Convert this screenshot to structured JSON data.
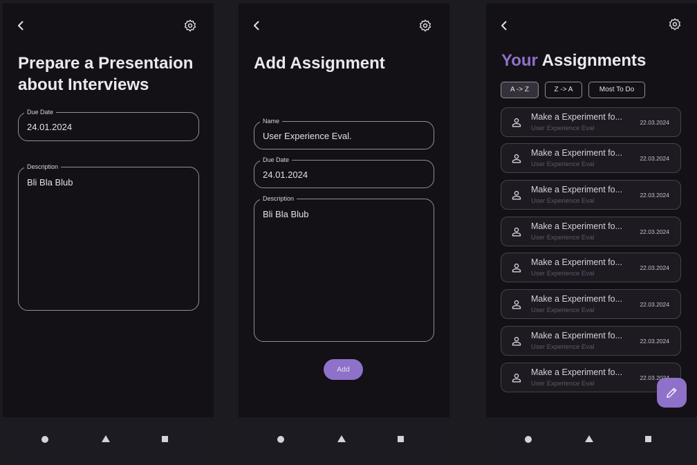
{
  "screen1": {
    "title": "Prepare a Presentaion about Interviews",
    "due_date_label": "Due Date",
    "due_date_value": "24.01.2024",
    "description_label": "Description",
    "description_value": "Bli Bla Blub"
  },
  "screen2": {
    "title": "Add Assignment",
    "name_label": "Name",
    "name_value": "User Experience Eval.",
    "due_date_label": "Due Date",
    "due_date_value": "24.01.2024",
    "description_label": "Description",
    "description_value": "Bli Bla Blub",
    "add_label": "Add"
  },
  "screen3": {
    "title_accent": "Your",
    "title_rest": " Assignments",
    "sort_options": [
      "A -> Z",
      "Z -> A",
      "Most To Do"
    ],
    "selected_sort": "A -> Z",
    "assignments": [
      {
        "title": "Make a Experiment fo...",
        "subtitle": "User Experience Eval",
        "date": "22.03.2024"
      },
      {
        "title": "Make a Experiment fo...",
        "subtitle": "User Experience Eval",
        "date": "22.03.2024"
      },
      {
        "title": "Make a Experiment fo...",
        "subtitle": "User Experience Eval",
        "date": "22.03.2024"
      },
      {
        "title": "Make a Experiment fo...",
        "subtitle": "User Experience Eval",
        "date": "22.03.2024"
      },
      {
        "title": "Make a Experiment fo...",
        "subtitle": "User Experience Eval",
        "date": "22.03.2024"
      },
      {
        "title": "Make a Experiment fo...",
        "subtitle": "User Experience Eval",
        "date": "22.03.2024"
      },
      {
        "title": "Make a Experiment fo...",
        "subtitle": "User Experience Eval",
        "date": "22.03.2024"
      },
      {
        "title": "Make a Experiment fo...",
        "subtitle": "User Experience Eval",
        "date": "22.03.2024"
      }
    ]
  },
  "icons": {
    "back": "back-icon",
    "settings": "gear-icon",
    "person": "person-icon",
    "edit": "pencil-icon",
    "nav_home": "circle",
    "nav_back": "triangle",
    "nav_recents": "square"
  },
  "colors": {
    "accent": "#8e71c9",
    "background": "#131016",
    "outline": "#938f99",
    "navbar": "#1d1b22"
  }
}
